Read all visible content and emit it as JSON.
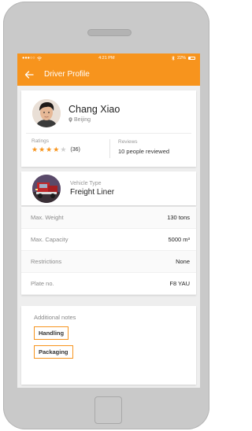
{
  "status_bar": {
    "carrier": "●●●○○",
    "time": "4:21 PM",
    "battery": "22%"
  },
  "nav": {
    "title": "Driver Profile",
    "back_icon": "arrow-left-icon"
  },
  "profile": {
    "name": "Chang Xiao",
    "location": "Beijing"
  },
  "stats": {
    "ratings_label": "Ratings",
    "rating_stars": 4,
    "rating_max": 5,
    "rating_count": "(36)",
    "reviews_label": "Reviews",
    "reviews_value": "10 people reviewed"
  },
  "vehicle": {
    "label": "Vehicle Type",
    "value": "Freight Liner"
  },
  "specs": [
    {
      "label": "Max. Weight",
      "value": "130 tons"
    },
    {
      "label": "Max. Capacity",
      "value": "5000 m³"
    },
    {
      "label": "Restrictions",
      "value": "None"
    },
    {
      "label": "Plate no.",
      "value": "F8 YAU"
    }
  ],
  "notes": {
    "title": "Additional notes",
    "tags": [
      "Handling",
      "Packaging"
    ]
  },
  "colors": {
    "accent": "#f7941d",
    "screen_bg": "#eeeeee"
  }
}
